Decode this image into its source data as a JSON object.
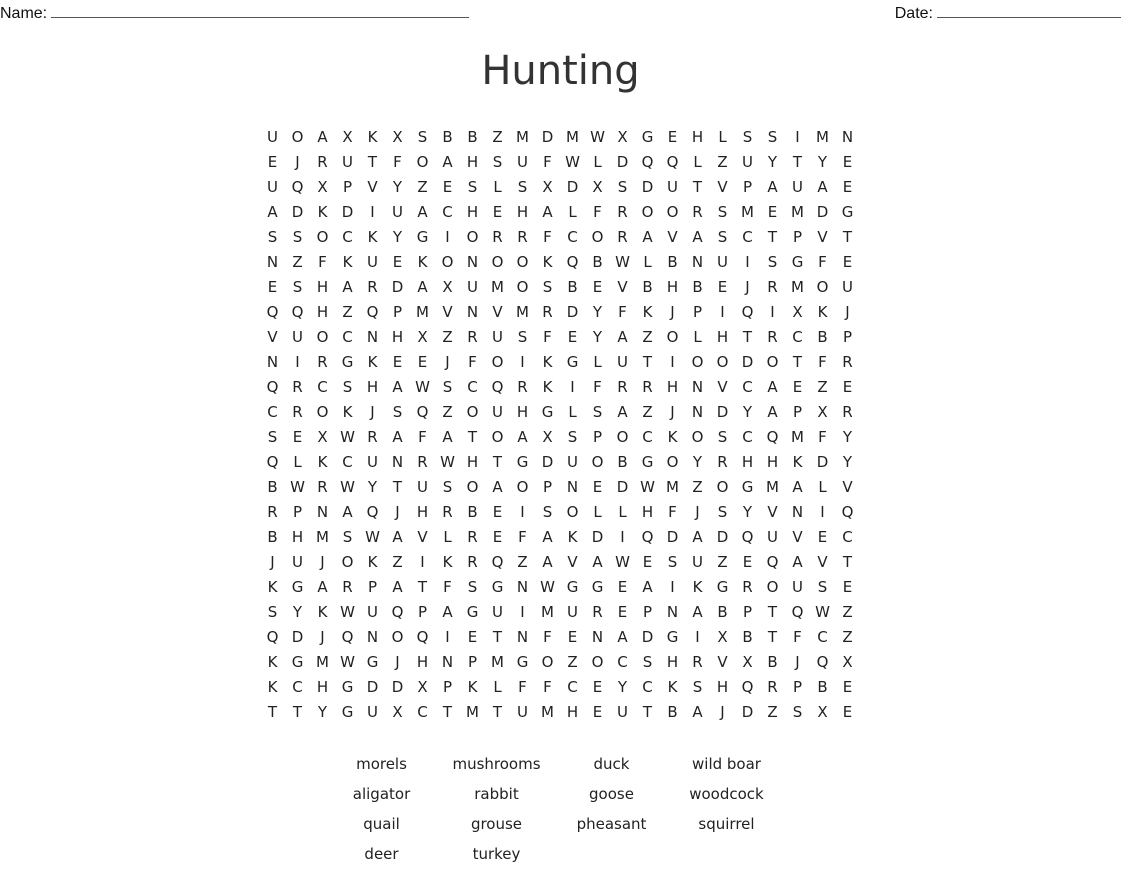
{
  "header": {
    "name_label": "Name:",
    "date_label": "Date:"
  },
  "title": "Hunting",
  "grid": [
    "UOAXKXSBBZMDMWXGEHLSSIMN",
    "EJRUTFOAHSUFWLDQQLZUYTYE",
    "UQXPVYZESLSXDXSDUTVPAUAE",
    "ADKDIUACHEHALFROORSMEMDG",
    "SSOCKYGIORRFCORAVASCTPVT",
    "NZFKUEKONOOKQBWLBNUISGFE",
    "ESHARDAXUMOSBEVBHBEJRMOU",
    "QQHZQPMVNVMRDYFKJPIQIXKJ",
    "VUOCNHXZRUSFEYAZOLHTRCBP",
    "NIRGKEEJFOIKGLUTIOODOTFR",
    "QRCSHAWSCQRKIFRRHNVCAEZE",
    "CROKJSQZOUHGLSAZJNDYAPXR",
    "SEXWRAFATOAXSPOCKOSCQMFY",
    "QLKCUNRWHTGDUOBGOYRHHKDY",
    "BWRWYTUSOAOPNEDWMZOGMALV",
    "RPNAQJHRBEISOLLHFJSYVNIQ",
    "BHMSWAVLREFAKDIQDADQUVEC",
    "JUJOKZIKRQZAVAWESUZEQAVT",
    "KGARPATFSGNWGGEAIKGROUSE",
    "SYKWUQPAGUIMUREPNABPTQWZ",
    "QDJQNOQIETNFENADGIXBTFCZ",
    "KGMWGJHNPMGOZOCSHRVXBJQX",
    "KCHGDDXPKLFFCEYCKSHQRPBE",
    "TTYGUXCTMTUMHEUTBAJDZSXE"
  ],
  "word_bank": [
    "morels",
    "mushrooms",
    "duck",
    "wild boar",
    "aligator",
    "rabbit",
    "goose",
    "woodcock",
    "quail",
    "grouse",
    "pheasant",
    "squirrel",
    "deer",
    "turkey"
  ]
}
